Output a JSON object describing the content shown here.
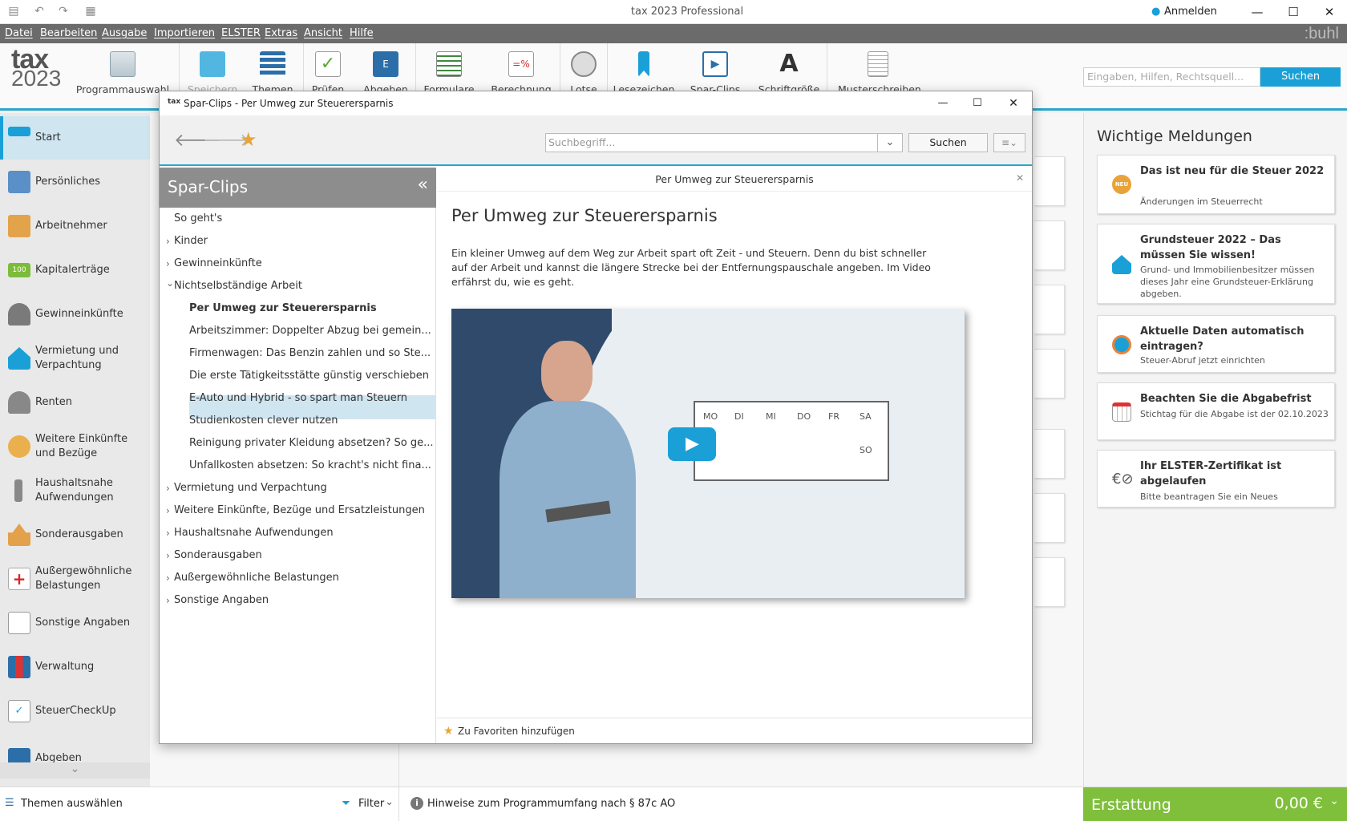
{
  "app": {
    "title": "tax 2023 Professional",
    "login": "Anmelden",
    "brand": ":buhl"
  },
  "menu": [
    "Datei",
    "Bearbeiten",
    "Ausgabe",
    "Importieren",
    "ELSTER",
    "Extras",
    "Ansicht",
    "Hilfe"
  ],
  "logo": {
    "line1": "tax",
    "line2": "2023"
  },
  "ribbon": {
    "items": [
      {
        "label": "Programmauswahl",
        "icon": "program-select-icon"
      },
      {
        "label": "Speichern",
        "icon": "save-icon"
      },
      {
        "label": "Themen",
        "icon": "topics-icon"
      },
      {
        "label": "Prüfen",
        "icon": "check-icon"
      },
      {
        "label": "Abgeben",
        "icon": "submit-icon"
      },
      {
        "label": "Formulare",
        "icon": "forms-icon"
      },
      {
        "label": "Berechnung",
        "icon": "calculation-icon"
      },
      {
        "label": "Lotse",
        "icon": "compass-icon"
      },
      {
        "label": "Lesezeichen",
        "icon": "bookmark-icon"
      },
      {
        "label": "Spar-Clips",
        "icon": "video-icon"
      },
      {
        "label": "Schriftgröße",
        "icon": "font-size-icon"
      },
      {
        "label": "Musterschreiben",
        "icon": "template-letter-icon"
      }
    ],
    "search_placeholder": "Eingaben, Hilfen, Rechtsquell...",
    "search_button": "Suchen"
  },
  "sidebar": {
    "items": [
      {
        "label": "Start"
      },
      {
        "label": "Persönliches"
      },
      {
        "label": "Arbeitnehmer"
      },
      {
        "label": "Kapitalerträge",
        "badge": "100"
      },
      {
        "label": "Gewinneinkünfte"
      },
      {
        "label": "Vermietung und Verpachtung"
      },
      {
        "label": "Renten"
      },
      {
        "label": "Weitere Einkünfte und Bezüge"
      },
      {
        "label": "Haushaltsnahe Aufwendungen"
      },
      {
        "label": "Sonderausgaben"
      },
      {
        "label": "Außergewöhnliche Belastungen"
      },
      {
        "label": "Sonstige Angaben"
      },
      {
        "label": "Verwaltung"
      },
      {
        "label": "SteuerCheckUp"
      },
      {
        "label": "Abgeben"
      }
    ]
  },
  "right_panel": {
    "title": "Wichtige Meldungen",
    "cards": [
      {
        "title": "Das ist neu für die Steuer 2022",
        "text": "Änderungen im Steuerrecht",
        "icon": "new-badge-icon",
        "badge": "NEU"
      },
      {
        "title": "Grundsteuer 2022 – Das müssen Sie wissen!",
        "text": "Grund- und Immobilienbesitzer müssen dieses Jahr eine Grundsteuer-Erklärung abgeben.",
        "icon": "house-icon"
      },
      {
        "title": "Aktuelle Daten automatisch eintragen?",
        "text": "Steuer-Abruf jetzt einrichten",
        "icon": "data-fetch-icon"
      },
      {
        "title": "Beachten Sie die Abgabefrist",
        "text": "Stichtag für die Abgabe ist der 02.10.2023",
        "icon": "calendar-icon"
      },
      {
        "title": "Ihr ELSTER-Zertifikat ist abgelaufen",
        "text": "Bitte beantragen Sie ein Neues",
        "icon": "elster-certificate-icon"
      }
    ]
  },
  "status": {
    "themes": "Themen auswählen",
    "filter": "Filter",
    "hint": "Hinweise zum Programmumfang nach § 87c AO",
    "refund_label": "Erstattung",
    "refund_value": "0,00 €"
  },
  "dialog": {
    "title": "Spar-Clips - Per Umweg zur Steuerersparnis",
    "app_icon": "tax",
    "search_placeholder": "Suchbegriff...",
    "search_button": "Suchen",
    "tree_title": "Spar-Clips",
    "tree": [
      {
        "label": "So geht's",
        "level": 0,
        "arrow": ""
      },
      {
        "label": "Kinder",
        "level": 0,
        "arrow": "›"
      },
      {
        "label": "Gewinneinkünfte",
        "level": 0,
        "arrow": "›"
      },
      {
        "label": "Nichtselbständige Arbeit",
        "level": 0,
        "arrow": "⌄"
      },
      {
        "label": "Per Umweg zur Steuerersparnis",
        "level": 1,
        "arrow": "",
        "selected": true
      },
      {
        "label": "Arbeitszimmer: Doppelter Abzug bei gemein...",
        "level": 1,
        "arrow": ""
      },
      {
        "label": "Firmenwagen: Das Benzin zahlen und so Ste...",
        "level": 1,
        "arrow": ""
      },
      {
        "label": "Die erste Tätigkeitsstätte günstig verschieben",
        "level": 1,
        "arrow": ""
      },
      {
        "label": "E-Auto und Hybrid - so spart man Steuern",
        "level": 1,
        "arrow": ""
      },
      {
        "label": "Studienkosten clever nutzen",
        "level": 1,
        "arrow": ""
      },
      {
        "label": "Reinigung privater Kleidung absetzen? So ge...",
        "level": 1,
        "arrow": ""
      },
      {
        "label": "Unfallkosten absetzen: So kracht's nicht fina...",
        "level": 1,
        "arrow": ""
      },
      {
        "label": "Vermietung und Verpachtung",
        "level": 0,
        "arrow": "›"
      },
      {
        "label": "Weitere Einkünfte, Bezüge und Ersatzleistungen",
        "level": 0,
        "arrow": "›"
      },
      {
        "label": "Haushaltsnahe Aufwendungen",
        "level": 0,
        "arrow": "›"
      },
      {
        "label": "Sonderausgaben",
        "level": 0,
        "arrow": "›"
      },
      {
        "label": "Außergewöhnliche Belastungen",
        "level": 0,
        "arrow": "›"
      },
      {
        "label": "Sonstige Angaben",
        "level": 0,
        "arrow": "›"
      }
    ],
    "content_tab": "Per Umweg zur Steuerersparnis",
    "content_heading": "Per Umweg zur Steuerersparnis",
    "content_text": "Ein kleiner Umweg auf dem Weg zur Arbeit spart oft Zeit - und Steuern. Denn du bist schneller auf der Arbeit und kannst die längere Strecke bei der Entfernungspauschale angeben. Im Video erfährst du, wie es geht.",
    "weekdays": [
      "MO",
      "DI",
      "MI",
      "DO",
      "FR",
      "SA",
      "SO"
    ],
    "favorites": "Zu Favoriten hinzufügen"
  },
  "colors": {
    "accent": "#1aa0d7",
    "menubar": "#6b6b6b",
    "refund": "#7fbf3b",
    "teal": "#2aa6c8"
  }
}
